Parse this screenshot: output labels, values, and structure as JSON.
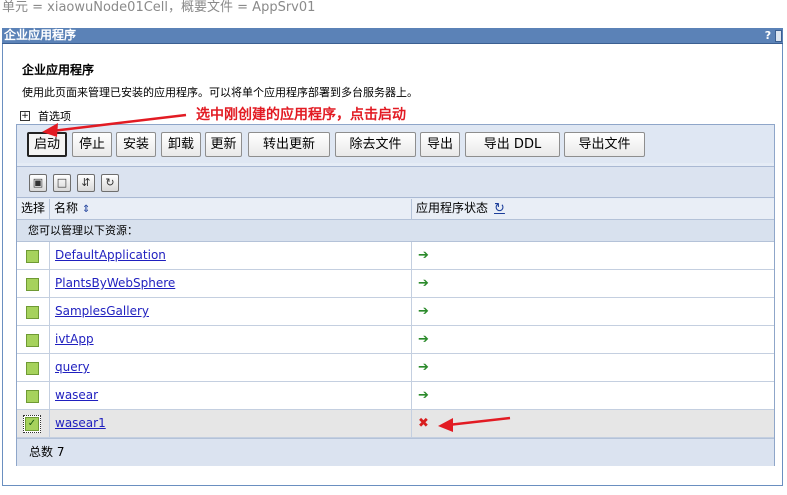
{
  "context": {
    "text": "单元  = xiaowuNode01Cell，概要文件  = AppSrv01"
  },
  "portlet": {
    "title": "企业应用程序",
    "help": "?"
  },
  "section": {
    "title": "企业应用程序",
    "description": "使用此页面来管理已安装的应用程序。可以将单个应用程序部署到多台服务器上。"
  },
  "preferences": {
    "expander": "+",
    "label": "首选项"
  },
  "annotation": {
    "text": "选中刚创建的应用程序，点击启动"
  },
  "buttons": {
    "start": "启动",
    "stop": "停止",
    "install": "安装",
    "uninstall": "卸载",
    "update": "更新",
    "rollout": "转出更新",
    "remove_file": "除去文件",
    "export": "导出",
    "export_ddl": "导出 DDL",
    "export_file": "导出文件"
  },
  "toolbar_icons": [
    "select-all-icon",
    "deselect-all-icon",
    "show-filter-icon",
    "clear-filter-icon"
  ],
  "table": {
    "headers": {
      "select": "选择",
      "name": "名称",
      "status": "应用程序状态"
    },
    "resources_note": "您可以管理以下资源：",
    "rows": [
      {
        "name": "DefaultApplication",
        "status": "running",
        "checked": false
      },
      {
        "name": "PlantsByWebSphere",
        "status": "running",
        "checked": false
      },
      {
        "name": "SamplesGallery",
        "status": "running",
        "checked": false
      },
      {
        "name": "ivtApp",
        "status": "running",
        "checked": false
      },
      {
        "name": "query",
        "status": "running",
        "checked": false
      },
      {
        "name": "wasear",
        "status": "running",
        "checked": false
      },
      {
        "name": "wasear1",
        "status": "stopped",
        "checked": true
      }
    ],
    "total": "总数  7"
  },
  "colors": {
    "header": "#5b82b7",
    "panel": "#e5ecf6",
    "link": "#1f1fbf",
    "running": "#2a8a2a",
    "stopped": "#d81e1e",
    "annotation": "#e21b23"
  }
}
